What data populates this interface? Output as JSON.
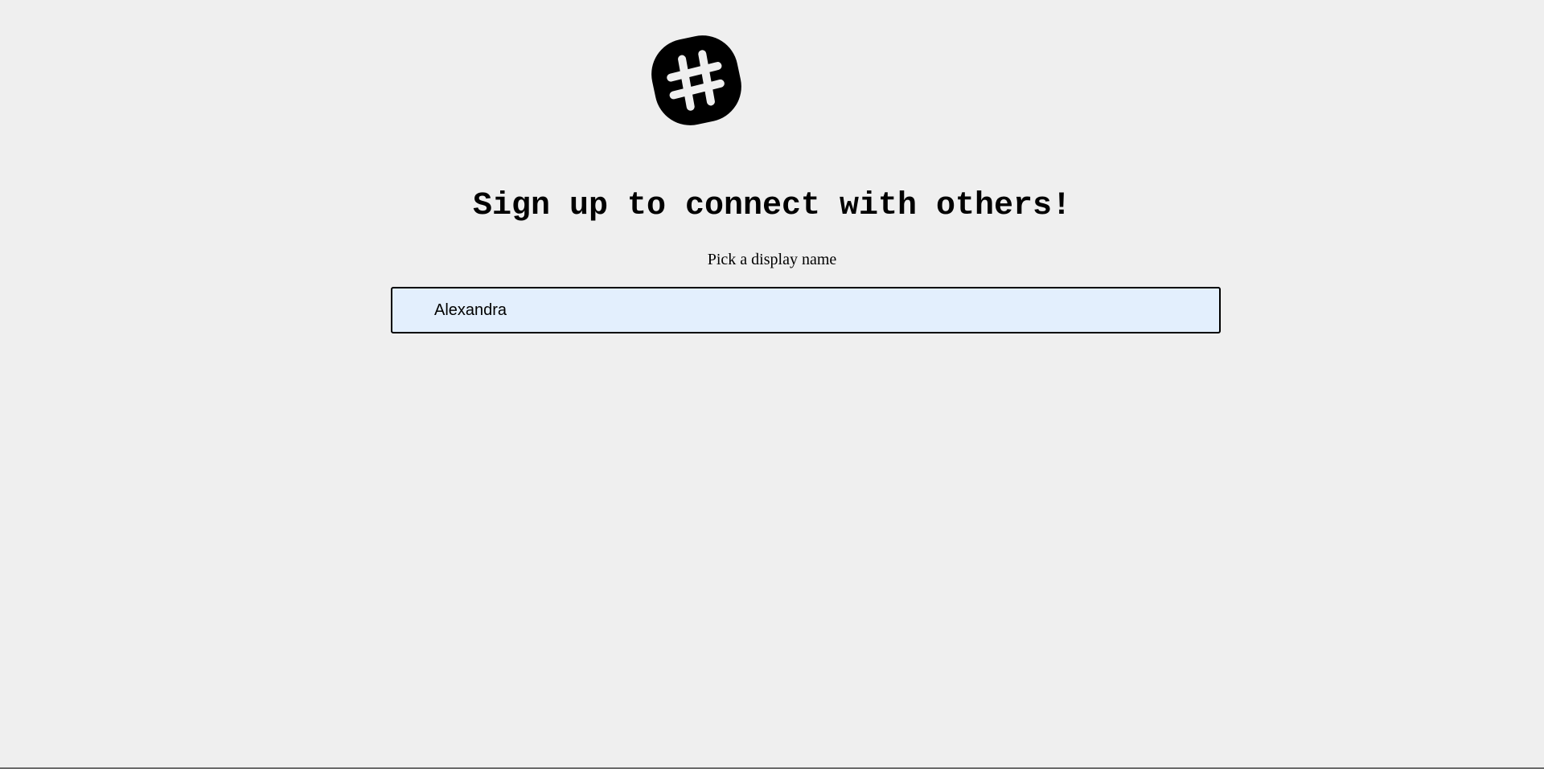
{
  "logo": {
    "icon": "hashtag-icon",
    "color": "#000000"
  },
  "signup": {
    "heading": "Sign up to connect with others!",
    "subtitle": "Pick a display name",
    "display_name_value": "Alexandra",
    "input_background": "#e3effd"
  }
}
